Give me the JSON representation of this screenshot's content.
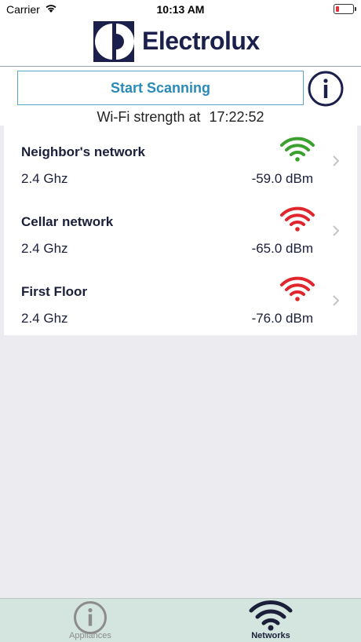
{
  "status_bar": {
    "carrier": "Carrier",
    "time": "10:13 AM",
    "wifi_icon": "wifi-icon",
    "battery_icon": "battery-icon",
    "battery_color": "#e0323a"
  },
  "header": {
    "logo_icon": "electrolux-logo-icon",
    "brand": "Electrolux",
    "brand_color": "#1b1f4b"
  },
  "controls": {
    "scan_label": "Start Scanning",
    "scan_color": "#2a8ab8",
    "info_icon": "info-icon",
    "wifi_strength_label": "Wi-Fi strength at",
    "wifi_strength_time": "17:22:52"
  },
  "networks": [
    {
      "name": "Neighbor's network",
      "band": "2.4 Ghz",
      "dbm": "-59.0 dBm",
      "signal_color": "#3aa02e",
      "signal_icon": "wifi-signal-icon"
    },
    {
      "name": "Cellar network",
      "band": "2.4 Ghz",
      "dbm": "-65.0 dBm",
      "signal_color": "#e0252c",
      "signal_icon": "wifi-signal-icon"
    },
    {
      "name": "First Floor",
      "band": "2.4 Ghz",
      "dbm": "-76.0 dBm",
      "signal_color": "#e0252c",
      "signal_icon": "wifi-signal-icon"
    }
  ],
  "tab_bar": {
    "tabs": [
      {
        "label": "Appliances",
        "icon": "info-icon",
        "active": false,
        "color": "#8c8c8c"
      },
      {
        "label": "Networks",
        "icon": "wifi-icon",
        "active": true,
        "color": "#1b1f3a"
      }
    ]
  }
}
